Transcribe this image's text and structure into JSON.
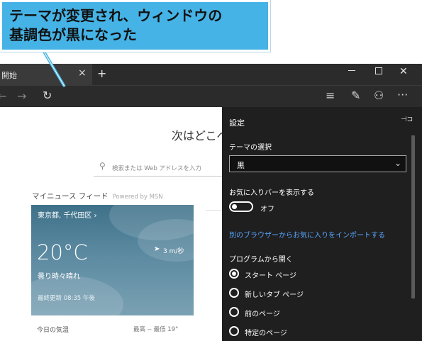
{
  "callout": {
    "text_line1": "テーマが変更され、ウィンドウの",
    "text_line2": "基調色が黒になった"
  },
  "tab": {
    "title": "開始",
    "close": "×",
    "new_tab": "+"
  },
  "window": {
    "close": "✕"
  },
  "toolbar": {
    "back": "←",
    "forward": "→",
    "refresh": "↻",
    "hub": "≡",
    "note": "✎",
    "share": "⚇",
    "more": "···"
  },
  "page": {
    "heading": "次はどこへ",
    "search_placeholder": "検索または Web アドレスを入力",
    "news_title": "マイニュース フィード",
    "powered_by": "Powered by MSN",
    "weather": {
      "location": "東京都, 千代田区 ›",
      "temp": "20°C",
      "wind": "3 m/秒",
      "condition": "曇り時々晴れ",
      "updated": "最終更新 08:35 午後",
      "today": "今日の気温",
      "hilo": "最高 --  最低 19°"
    }
  },
  "settings": {
    "title": "設定",
    "pin": "⊣⊐",
    "theme_label": "テーマの選択",
    "theme_value": "黒",
    "favorites_label": "お気に入りバーを表示する",
    "toggle_state": "オフ",
    "import_link": "別のブラウザーからお気に入りをインポートする",
    "open_label": "プログラムから開く",
    "open_options": [
      "スタート ページ",
      "新しいタブ ページ",
      "前のページ",
      "特定のページ"
    ],
    "selected_option": 0
  },
  "colors": {
    "callout": "#45b3e6",
    "panel": "#1f1f1f",
    "chrome": "#2b2b2b",
    "link": "#58a5ff"
  }
}
